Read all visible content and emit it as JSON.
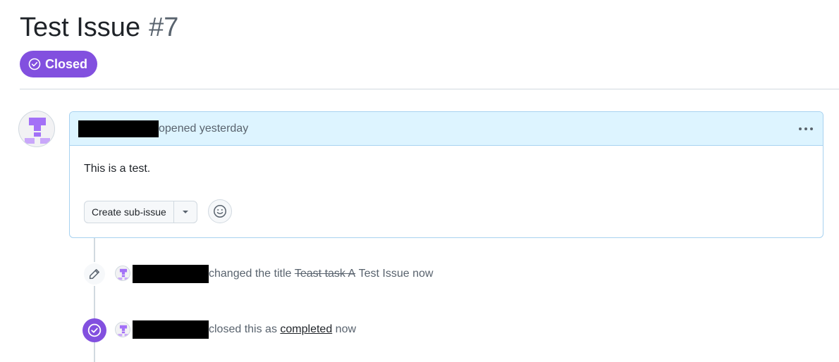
{
  "issue": {
    "title": "Test Issue",
    "number": "#7",
    "state_label": "Closed"
  },
  "comment": {
    "action_text": "opened yesterday",
    "body": "This is a test.",
    "create_sub_issue_label": "Create sub-issue"
  },
  "events": [
    {
      "action": "changed the title",
      "old_title": "Teast task A",
      "new_title": "Test Issue",
      "time": "now"
    },
    {
      "action": "closed this as",
      "reason": "completed",
      "time": "now"
    }
  ],
  "colors": {
    "closed_purple": "#8250df",
    "header_blue": "#ddf4ff",
    "border_blue": "#a8d2f0",
    "muted_text": "#59636e",
    "avatar_purple": "#a371f7"
  },
  "icons": {
    "state": "check-circle-icon",
    "more": "kebab-horizontal-icon",
    "caret": "triangle-down-icon",
    "emoji": "smiley-icon",
    "edit_event": "pencil-icon",
    "closed_event": "check-circle-icon"
  }
}
